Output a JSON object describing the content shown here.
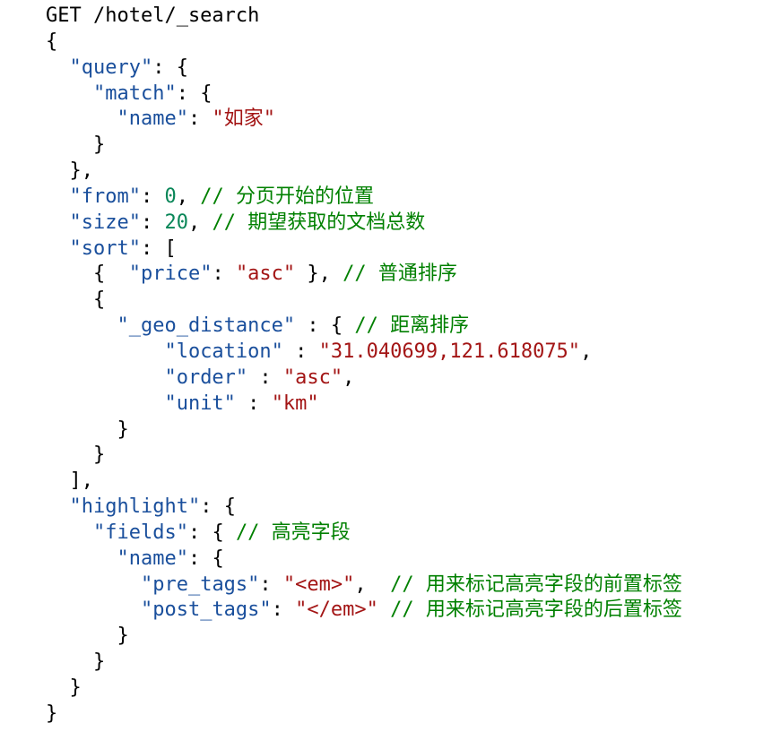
{
  "colors": {
    "key": "#1a4f9c",
    "string": "#a31515",
    "number": "#098658",
    "comment": "#008000",
    "plain": "#000000"
  },
  "lines": [
    [
      {
        "t": "p",
        "v": "GET /hotel/_search"
      }
    ],
    [
      {
        "t": "p",
        "v": "{"
      }
    ],
    [
      {
        "t": "p",
        "v": "  "
      },
      {
        "t": "k",
        "v": "\"query\""
      },
      {
        "t": "p",
        "v": ": {"
      }
    ],
    [
      {
        "t": "p",
        "v": "    "
      },
      {
        "t": "k",
        "v": "\"match\""
      },
      {
        "t": "p",
        "v": ": {"
      }
    ],
    [
      {
        "t": "p",
        "v": "      "
      },
      {
        "t": "k",
        "v": "\"name\""
      },
      {
        "t": "p",
        "v": ": "
      },
      {
        "t": "s",
        "v": "\"如家\""
      }
    ],
    [
      {
        "t": "p",
        "v": "    }"
      }
    ],
    [
      {
        "t": "p",
        "v": "  },"
      }
    ],
    [
      {
        "t": "p",
        "v": "  "
      },
      {
        "t": "k",
        "v": "\"from\""
      },
      {
        "t": "p",
        "v": ": "
      },
      {
        "t": "n",
        "v": "0"
      },
      {
        "t": "p",
        "v": ", "
      },
      {
        "t": "c",
        "v": "// 分页开始的位置"
      }
    ],
    [
      {
        "t": "p",
        "v": "  "
      },
      {
        "t": "k",
        "v": "\"size\""
      },
      {
        "t": "p",
        "v": ": "
      },
      {
        "t": "n",
        "v": "20"
      },
      {
        "t": "p",
        "v": ", "
      },
      {
        "t": "c",
        "v": "// 期望获取的文档总数"
      }
    ],
    [
      {
        "t": "p",
        "v": "  "
      },
      {
        "t": "k",
        "v": "\"sort\""
      },
      {
        "t": "p",
        "v": ": ["
      }
    ],
    [
      {
        "t": "p",
        "v": "    {  "
      },
      {
        "t": "k",
        "v": "\"price\""
      },
      {
        "t": "p",
        "v": ": "
      },
      {
        "t": "s",
        "v": "\"asc\""
      },
      {
        "t": "p",
        "v": " }, "
      },
      {
        "t": "c",
        "v": "// 普通排序"
      }
    ],
    [
      {
        "t": "p",
        "v": "    {"
      }
    ],
    [
      {
        "t": "p",
        "v": "      "
      },
      {
        "t": "k",
        "v": "\"_geo_distance\""
      },
      {
        "t": "p",
        "v": " : { "
      },
      {
        "t": "c",
        "v": "// 距离排序"
      }
    ],
    [
      {
        "t": "p",
        "v": "          "
      },
      {
        "t": "k",
        "v": "\"location\""
      },
      {
        "t": "p",
        "v": " : "
      },
      {
        "t": "s",
        "v": "\"31.040699,121.618075\""
      },
      {
        "t": "p",
        "v": ","
      }
    ],
    [
      {
        "t": "p",
        "v": "          "
      },
      {
        "t": "k",
        "v": "\"order\""
      },
      {
        "t": "p",
        "v": " : "
      },
      {
        "t": "s",
        "v": "\"asc\""
      },
      {
        "t": "p",
        "v": ","
      }
    ],
    [
      {
        "t": "p",
        "v": "          "
      },
      {
        "t": "k",
        "v": "\"unit\""
      },
      {
        "t": "p",
        "v": " : "
      },
      {
        "t": "s",
        "v": "\"km\""
      }
    ],
    [
      {
        "t": "p",
        "v": "      }"
      }
    ],
    [
      {
        "t": "p",
        "v": "    }"
      }
    ],
    [
      {
        "t": "p",
        "v": "  ],"
      }
    ],
    [
      {
        "t": "p",
        "v": "  "
      },
      {
        "t": "k",
        "v": "\"highlight\""
      },
      {
        "t": "p",
        "v": ": {"
      }
    ],
    [
      {
        "t": "p",
        "v": "    "
      },
      {
        "t": "k",
        "v": "\"fields\""
      },
      {
        "t": "p",
        "v": ": { "
      },
      {
        "t": "c",
        "v": "// 高亮字段"
      }
    ],
    [
      {
        "t": "p",
        "v": "      "
      },
      {
        "t": "k",
        "v": "\"name\""
      },
      {
        "t": "p",
        "v": ": {"
      }
    ],
    [
      {
        "t": "p",
        "v": "        "
      },
      {
        "t": "k",
        "v": "\"pre_tags\""
      },
      {
        "t": "p",
        "v": ": "
      },
      {
        "t": "s",
        "v": "\"<em>\""
      },
      {
        "t": "p",
        "v": ",  "
      },
      {
        "t": "c",
        "v": "// 用来标记高亮字段的前置标签"
      }
    ],
    [
      {
        "t": "p",
        "v": "        "
      },
      {
        "t": "k",
        "v": "\"post_tags\""
      },
      {
        "t": "p",
        "v": ": "
      },
      {
        "t": "s",
        "v": "\"</em>\""
      },
      {
        "t": "p",
        "v": " "
      },
      {
        "t": "c",
        "v": "// 用来标记高亮字段的后置标签"
      }
    ],
    [
      {
        "t": "p",
        "v": "      }"
      }
    ],
    [
      {
        "t": "p",
        "v": "    }"
      }
    ],
    [
      {
        "t": "p",
        "v": "  }"
      }
    ],
    [
      {
        "t": "p",
        "v": "}"
      }
    ]
  ]
}
